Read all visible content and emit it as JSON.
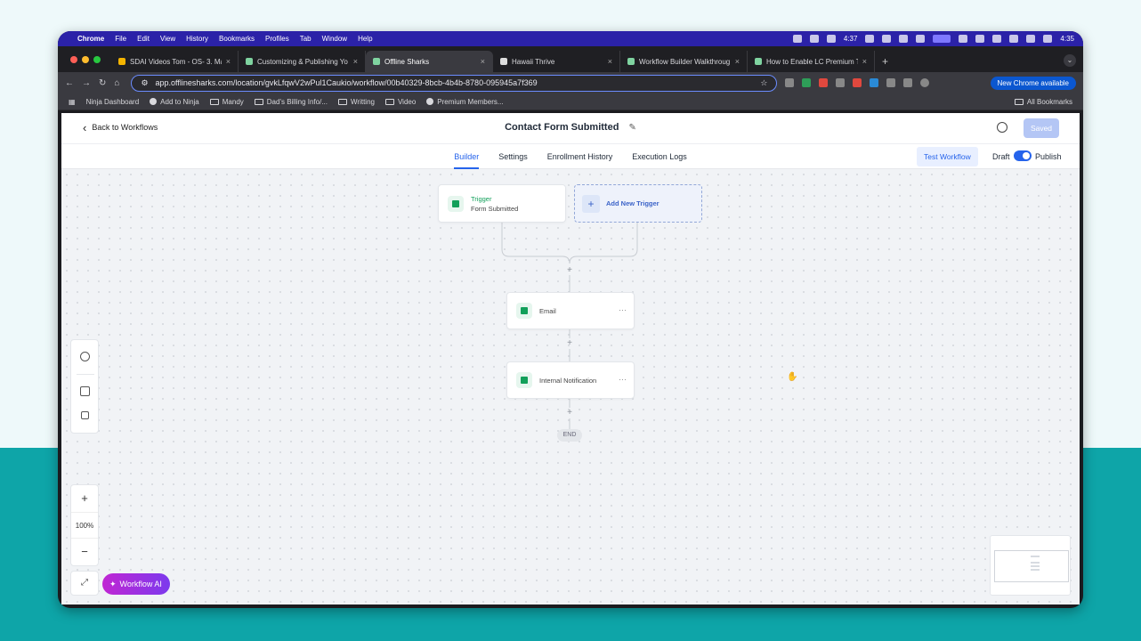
{
  "menubar": {
    "app": "Chrome",
    "items": [
      "File",
      "Edit",
      "View",
      "History",
      "Bookmarks",
      "Profiles",
      "Tab",
      "Window",
      "Help"
    ],
    "clock_left": "4:37",
    "clock_right": "4:35"
  },
  "browser": {
    "tabs": [
      {
        "title": "SDAI Videos Tom - OS- 3. Ma"
      },
      {
        "title": "Customizing & Publishing Yo"
      },
      {
        "title": "Offline Sharks"
      },
      {
        "title": "Hawaii Thrive"
      },
      {
        "title": "Workflow Builder Walkthroug"
      },
      {
        "title": "How to Enable LC Premium T"
      }
    ],
    "url": "app.offlinesharks.com/location/gvkLfqwV2wPul1Caukio/workflow/00b40329-8bcb-4b4b-8780-095945a7f369",
    "new_chrome_label": "New Chrome available",
    "bookmarks": [
      "Ninja Dashboard",
      "Add to Ninja",
      "Mandy",
      "Dad's Billing Info/...",
      "Writting",
      "Video",
      "Premium Members..."
    ],
    "all_bookmarks": "All Bookmarks"
  },
  "header": {
    "back_label": "Back to Workflows",
    "title": "Contact Form Submitted",
    "saved_label": "Saved"
  },
  "subnav": {
    "tabs": [
      "Builder",
      "Settings",
      "Enrollment History",
      "Execution Logs"
    ],
    "test_workflow": "Test Workflow",
    "draft": "Draft",
    "publish": "Publish"
  },
  "canvas": {
    "trigger_label": "Trigger",
    "trigger_name": "Form Submitted",
    "add_trigger": "Add New Trigger",
    "actions": [
      {
        "name": "Email"
      },
      {
        "name": "Internal Notification"
      }
    ],
    "end_label": "END",
    "zoom_level": "100%",
    "ai_button": "Workflow AI"
  },
  "colors": {
    "accent": "#2563eb",
    "node_icon": "#12a05a",
    "saved_button": "#b4c6f5",
    "menubar": "#2b22a8",
    "page_bottom": "#0ea5a8"
  }
}
